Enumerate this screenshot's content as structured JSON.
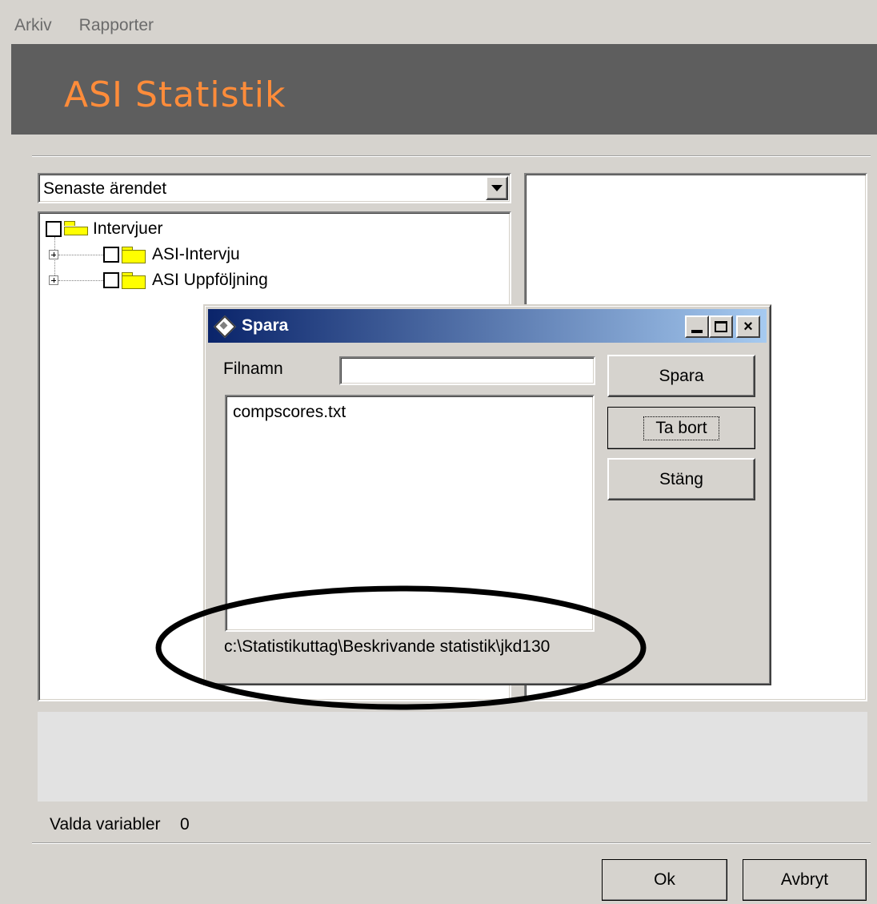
{
  "menu": {
    "items": [
      "Arkiv",
      "Rapporter"
    ]
  },
  "banner": {
    "title": "ASI Statistik"
  },
  "combo": {
    "value": "Senaste ärendet"
  },
  "tree": {
    "root": "Intervjuer",
    "children": [
      "ASI-Intervju",
      "ASI Uppföljning"
    ]
  },
  "status": {
    "valda_label": "Valda variabler",
    "valda_count": "0"
  },
  "buttons": {
    "ok": "Ok",
    "avbryt": "Avbryt"
  },
  "dialog": {
    "title": "Spara",
    "filnamn_label": "Filnamn",
    "filnamn_value": "",
    "files": [
      "compscores.txt"
    ],
    "path": "c:\\Statistikuttag\\Beskrivande statistik\\jkd130",
    "spara_label": "Spara",
    "tabort_label": "Ta bort",
    "stang_label": "Stäng",
    "min_symbol": "_",
    "close_symbol": "×"
  },
  "colors": {
    "banner_bg": "#5e5e5e",
    "banner_text": "#ff8c3a",
    "titlebar_start": "#0a246a",
    "titlebar_end": "#a6caf0"
  }
}
